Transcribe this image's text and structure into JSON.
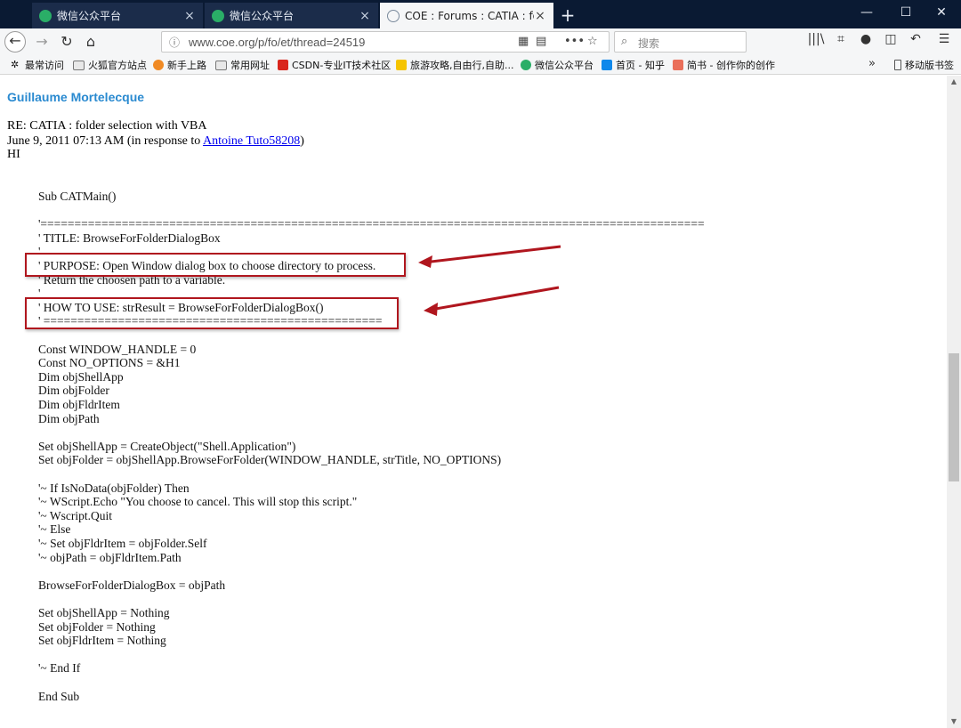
{
  "tabs": [
    {
      "title": "微信公众平台",
      "close": "×"
    },
    {
      "title": "微信公众平台",
      "close": "×"
    },
    {
      "title": "COE : Forums : CATIA : folder",
      "close": "×"
    }
  ],
  "new_tab": "+",
  "window_controls": {
    "minimize": "—",
    "maximize": "☐",
    "close": "✕"
  },
  "nav": {
    "back": "←",
    "forward": "→",
    "reload": "↻",
    "home": "⌂"
  },
  "url": {
    "text": "www.coe.org/p/fo/et/thread=24519"
  },
  "search": {
    "placeholder": "搜索",
    "icon": "search-icon"
  },
  "bookmarks": [
    {
      "label": "最常访问",
      "icon": "gear-icon"
    },
    {
      "label": "火狐官方站点",
      "icon": "folder-icon"
    },
    {
      "label": "新手上路",
      "icon": "firefox-icon"
    },
    {
      "label": "常用网址",
      "icon": "folder-icon"
    },
    {
      "label": "CSDN-专业IT技术社区",
      "icon": "csdn-icon"
    },
    {
      "label": "旅游攻略,自由行,自助...",
      "icon": "mafengwo-icon"
    },
    {
      "label": "微信公众平台",
      "icon": "wechat-icon"
    },
    {
      "label": "首页 - 知乎",
      "icon": "zhihu-icon"
    },
    {
      "label": "简书 - 创作你的创作",
      "icon": "jianshu-icon"
    }
  ],
  "bookmarks_more": "»",
  "mobile_bookmarks": "移动版书签",
  "post": {
    "author": "Guillaume Mortelecque",
    "subject": "RE: CATIA : folder selection with VBA",
    "date_prefix": "June 9, 2011 07:13 AM (in response to ",
    "in_response_to": "Antoine Tuto58208",
    "date_suffix": ")",
    "greeting": "HI"
  },
  "code_lines": [
    "Sub CATMain()",
    "",
    "'==================================================================================================",
    "' TITLE: BrowseForFolderDialogBox",
    "'",
    "' PURPOSE: Open Window dialog box to choose directory to process.",
    "' Return the choosen path to a variable.",
    "'",
    "' HOW TO USE: strResult = BrowseForFolderDialogBox()",
    "' ==================================================",
    "",
    "Const WINDOW_HANDLE = 0",
    "Const NO_OPTIONS = &H1",
    "Dim objShellApp",
    "Dim objFolder",
    "Dim objFldrItem",
    "Dim objPath",
    "",
    "Set objShellApp = CreateObject(\"Shell.Application\")",
    "Set objFolder = objShellApp.BrowseForFolder(WINDOW_HANDLE, strTitle, NO_OPTIONS)",
    "",
    "'~ If IsNoData(objFolder) Then",
    "'~ WScript.Echo \"You choose to cancel. This will stop this script.\"",
    "'~ Wscript.Quit",
    "'~ Else",
    "'~ Set objFldrItem = objFolder.Self",
    "'~ objPath = objFldrItem.Path",
    "",
    "BrowseForFolderDialogBox = objPath",
    "",
    "Set objShellApp = Nothing",
    "Set objFolder = Nothing",
    "Set objFldrItem = Nothing",
    "",
    "'~ End If",
    "",
    "End Sub"
  ],
  "colors": {
    "tabstrip": "#0a1a33",
    "highlight": "#b0161e",
    "author": "#2a8ad0",
    "link": "#0000ee"
  }
}
